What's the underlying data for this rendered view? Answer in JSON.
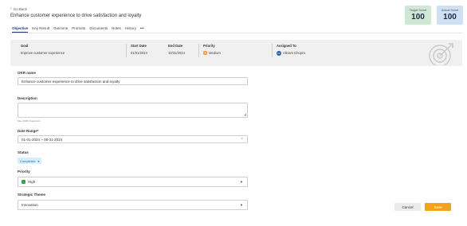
{
  "header": {
    "back_label": "Go Back",
    "title": "Enhance customer experience to drive satisfaction and loyalty"
  },
  "scores": {
    "target_label": "Target Score",
    "target_value": "100",
    "actual_label": "Actual Score",
    "actual_value": "100"
  },
  "tabs": [
    {
      "label": "Objective"
    },
    {
      "label": "Key Result"
    },
    {
      "label": "Outcome"
    },
    {
      "label": "Promote"
    },
    {
      "label": "Documents"
    },
    {
      "label": "Notes"
    },
    {
      "label": "History"
    },
    {
      "label": "•••"
    }
  ],
  "summary": {
    "goal_label": "Goal",
    "goal_value": "Improve customer experience",
    "start_label": "Start Date",
    "start_value": "01/01/2024",
    "end_label": "End Date",
    "end_value": "12/31/2024",
    "priority_label": "Priority",
    "priority_value": "Medium",
    "assigned_label": "Assigned To",
    "assigned_initials": "VC",
    "assigned_value": "Vikram Chopra"
  },
  "form": {
    "okr_name_label": "OKR name",
    "okr_name_value": "Enhance customer experience to drive satisfaction and loyalty",
    "description_label": "Description",
    "description_value": "",
    "description_helper": "Max 4000 Characters",
    "date_range_label": "Date Range*",
    "date_range_value": "01-01-2024 ~ 05-31-2024",
    "status_label": "Status",
    "status_value": "Completed",
    "priority_label": "Priority",
    "priority_value": "High",
    "theme_label": "Strategic Theme",
    "theme_value": "Innovation"
  },
  "actions": {
    "cancel_label": "Cancel",
    "save_label": "Save"
  },
  "colors": {
    "accent": "#f5a11c",
    "tab_active": "#1a3a7a",
    "target_bg": "#cfe8d6",
    "actual_bg": "#cfdff4",
    "summary_bg": "#f0f0f0"
  }
}
